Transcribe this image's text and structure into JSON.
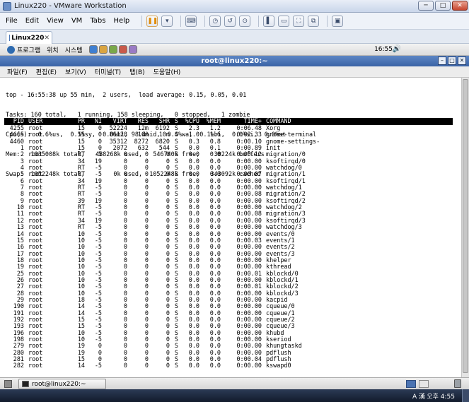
{
  "vmware": {
    "window_title": "Linux220 - VMware Workstation",
    "window_buttons": [
      "─",
      "□",
      "✕"
    ],
    "menu": [
      "File",
      "Edit",
      "View",
      "VM",
      "Tabs",
      "Help"
    ],
    "tab_label": "Linux220",
    "tab_close": "✕"
  },
  "guest_panel": {
    "menus": [
      "프로그램",
      "위치",
      "시스템"
    ],
    "clock": "16:55",
    "volume_glyph": "🔊"
  },
  "terminal": {
    "title": "root@linux220:~",
    "title_buttons": [
      "–",
      "□",
      "✕"
    ],
    "menu": [
      "파일(F)",
      "편집(E)",
      "보기(V)",
      "터미널(T)",
      "탭(B)",
      "도움말(H)"
    ],
    "summary_lines": [
      "top - 16:55:38 up 55 min,  2 users,  load average: 0.15, 0.05, 0.01",
      "Tasks: 160 total,   1 running, 158 sleeping,   0 stopped,   1 zombie",
      "Cpu(s):  0.6%us,  0.5%sy,  0.0%ni, 98.4%id,  0.4%wa,  0.1%hi,  0.0%si,  0.0%st",
      "Mem:   1035008k total,   488268k used,   546740k free,    30224k buffers",
      "Swap:  1052248k total,        0k used,  1052248k free,   343092k cached"
    ],
    "columns": [
      "PID",
      "USER",
      "PR",
      "NI",
      "VIRT",
      "RES",
      "SHR",
      "S",
      "%CPU",
      "%MEM",
      "TIME+",
      "COMMAND"
    ],
    "processes": [
      [
        "4255",
        "root",
        "15",
        "0",
        "52224",
        "12m",
        "6192",
        "S",
        "2.3",
        "1.2",
        "0:06.48",
        "Xorg"
      ],
      [
        "4665",
        "root",
        "15",
        "0",
        "86128",
        "16m",
        "10m",
        "S",
        "1.0",
        "1.6",
        "0:02.33",
        "gnome-terminal"
      ],
      [
        "4460",
        "root",
        "15",
        "0",
        "35312",
        "8272",
        "6820",
        "S",
        "0.3",
        "0.8",
        "0:00.10",
        "gnome-settings-"
      ],
      [
        "1",
        "root",
        "15",
        "0",
        "2072",
        "632",
        "544",
        "S",
        "0.0",
        "0.1",
        "0:00.89",
        "init"
      ],
      [
        "2",
        "root",
        "RT",
        "-5",
        "0",
        "0",
        "0",
        "S",
        "0.0",
        "0.0",
        "0:00.12",
        "migration/0"
      ],
      [
        "3",
        "root",
        "34",
        "19",
        "0",
        "0",
        "0",
        "S",
        "0.0",
        "0.0",
        "0:00.00",
        "ksoftirqd/0"
      ],
      [
        "4",
        "root",
        "RT",
        "-5",
        "0",
        "0",
        "0",
        "S",
        "0.0",
        "0.0",
        "0:00.00",
        "watchdog/0"
      ],
      [
        "5",
        "root",
        "RT",
        "-5",
        "0",
        "0",
        "0",
        "S",
        "0.0",
        "0.0",
        "0:00.07",
        "migration/1"
      ],
      [
        "6",
        "root",
        "34",
        "19",
        "0",
        "0",
        "0",
        "S",
        "0.0",
        "0.0",
        "0:00.00",
        "ksoftirqd/1"
      ],
      [
        "7",
        "root",
        "RT",
        "-5",
        "0",
        "0",
        "0",
        "S",
        "0.0",
        "0.0",
        "0:00.00",
        "watchdog/1"
      ],
      [
        "8",
        "root",
        "RT",
        "-5",
        "0",
        "0",
        "0",
        "S",
        "0.0",
        "0.0",
        "0:00.08",
        "migration/2"
      ],
      [
        "9",
        "root",
        "39",
        "19",
        "0",
        "0",
        "0",
        "S",
        "0.0",
        "0.0",
        "0:00.00",
        "ksoftirqd/2"
      ],
      [
        "10",
        "root",
        "RT",
        "-5",
        "0",
        "0",
        "0",
        "S",
        "0.0",
        "0.0",
        "0:00.00",
        "watchdog/2"
      ],
      [
        "11",
        "root",
        "RT",
        "-5",
        "0",
        "0",
        "0",
        "S",
        "0.0",
        "0.0",
        "0:00.08",
        "migration/3"
      ],
      [
        "12",
        "root",
        "34",
        "19",
        "0",
        "0",
        "0",
        "S",
        "0.0",
        "0.0",
        "0:00.00",
        "ksoftirqd/3"
      ],
      [
        "13",
        "root",
        "RT",
        "-5",
        "0",
        "0",
        "0",
        "S",
        "0.0",
        "0.0",
        "0:00.00",
        "watchdog/3"
      ],
      [
        "14",
        "root",
        "10",
        "-5",
        "0",
        "0",
        "0",
        "S",
        "0.0",
        "0.0",
        "0:00.00",
        "events/0"
      ],
      [
        "15",
        "root",
        "10",
        "-5",
        "0",
        "0",
        "0",
        "S",
        "0.0",
        "0.0",
        "0:00.03",
        "events/1"
      ],
      [
        "16",
        "root",
        "10",
        "-5",
        "0",
        "0",
        "0",
        "S",
        "0.0",
        "0.0",
        "0:00.00",
        "events/2"
      ],
      [
        "17",
        "root",
        "10",
        "-5",
        "0",
        "0",
        "0",
        "S",
        "0.0",
        "0.0",
        "0:00.00",
        "events/3"
      ],
      [
        "18",
        "root",
        "10",
        "-5",
        "0",
        "0",
        "0",
        "S",
        "0.0",
        "0.0",
        "0:00.00",
        "khelper"
      ],
      [
        "19",
        "root",
        "10",
        "-5",
        "0",
        "0",
        "0",
        "S",
        "0.0",
        "0.0",
        "0:00.00",
        "kthread"
      ],
      [
        "25",
        "root",
        "10",
        "-5",
        "0",
        "0",
        "0",
        "S",
        "0.0",
        "0.0",
        "0:00.01",
        "kblockd/0"
      ],
      [
        "26",
        "root",
        "10",
        "-5",
        "0",
        "0",
        "0",
        "S",
        "0.0",
        "0.0",
        "0:00.00",
        "kblockd/1"
      ],
      [
        "27",
        "root",
        "10",
        "-5",
        "0",
        "0",
        "0",
        "S",
        "0.0",
        "0.0",
        "0:00.01",
        "kblockd/2"
      ],
      [
        "28",
        "root",
        "10",
        "-5",
        "0",
        "0",
        "0",
        "S",
        "0.0",
        "0.0",
        "0:00.00",
        "kblockd/3"
      ],
      [
        "29",
        "root",
        "18",
        "-5",
        "0",
        "0",
        "0",
        "S",
        "0.0",
        "0.0",
        "0:00.00",
        "kacpid"
      ],
      [
        "190",
        "root",
        "14",
        "-5",
        "0",
        "0",
        "0",
        "S",
        "0.0",
        "0.0",
        "0:00.00",
        "cqueue/0"
      ],
      [
        "191",
        "root",
        "14",
        "-5",
        "0",
        "0",
        "0",
        "S",
        "0.0",
        "0.0",
        "0:00.00",
        "cqueue/1"
      ],
      [
        "192",
        "root",
        "15",
        "-5",
        "0",
        "0",
        "0",
        "S",
        "0.0",
        "0.0",
        "0:00.00",
        "cqueue/2"
      ],
      [
        "193",
        "root",
        "15",
        "-5",
        "0",
        "0",
        "0",
        "S",
        "0.0",
        "0.0",
        "0:00.00",
        "cqueue/3"
      ],
      [
        "196",
        "root",
        "10",
        "-5",
        "0",
        "0",
        "0",
        "S",
        "0.0",
        "0.0",
        "0:00.00",
        "khubd"
      ],
      [
        "198",
        "root",
        "10",
        "-5",
        "0",
        "0",
        "0",
        "S",
        "0.0",
        "0.0",
        "0:00.00",
        "kseriod"
      ],
      [
        "279",
        "root",
        "19",
        "0",
        "0",
        "0",
        "0",
        "S",
        "0.0",
        "0.0",
        "0:00.00",
        "khungtaskd"
      ],
      [
        "280",
        "root",
        "19",
        "0",
        "0",
        "0",
        "0",
        "S",
        "0.0",
        "0.0",
        "0:00.00",
        "pdflush"
      ],
      [
        "281",
        "root",
        "15",
        "0",
        "0",
        "0",
        "0",
        "S",
        "0.0",
        "0.0",
        "0:00.04",
        "pdflush"
      ],
      [
        "282",
        "root",
        "14",
        "-5",
        "0",
        "0",
        "0",
        "S",
        "0.0",
        "0.0",
        "0:00.00",
        "kswapd0"
      ]
    ]
  },
  "guest_taskbar": {
    "task_label": "root@linux220:~"
  },
  "host_taskbar": {
    "tray_text": "A 漢",
    "clock": "오후 4:55"
  }
}
